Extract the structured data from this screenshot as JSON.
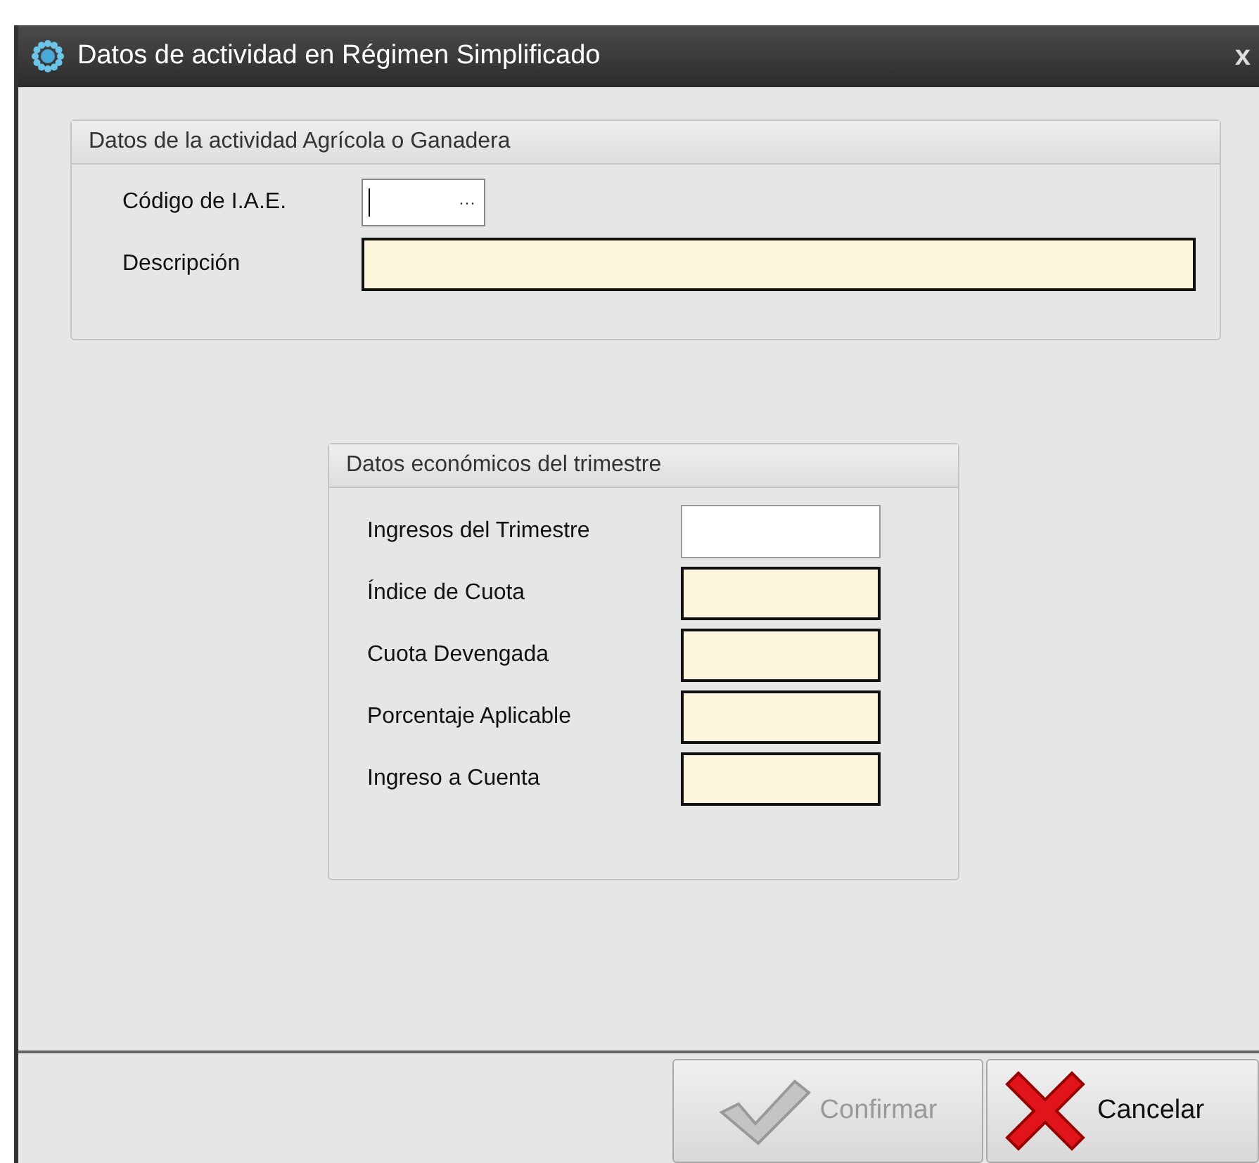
{
  "window": {
    "title": "Datos de actividad en Régimen Simplificado",
    "close": "x"
  },
  "activity_group": {
    "title": "Datos de la actividad Agrícola o Ganadera",
    "code": {
      "label": "Código de I.A.E.",
      "lookup": "···",
      "focused": true,
      "readonly": false
    },
    "description": {
      "label": "Descripción",
      "readonly": true
    }
  },
  "economic_group": {
    "title": "Datos económicos del trimestre",
    "fields": [
      {
        "label": "Ingresos del Trimestre",
        "readonly": false
      },
      {
        "label": "Índice de Cuota",
        "readonly": true
      },
      {
        "label": "Cuota Devengada",
        "readonly": true
      },
      {
        "label": "Porcentaje Aplicable",
        "readonly": true
      },
      {
        "label": "Ingreso a Cuenta",
        "readonly": true
      }
    ]
  },
  "buttons": [
    {
      "kind": "confirm",
      "label": "Confirmar",
      "disabled": true
    },
    {
      "kind": "cancel",
      "label": "Cancelar",
      "disabled": false
    }
  ]
}
